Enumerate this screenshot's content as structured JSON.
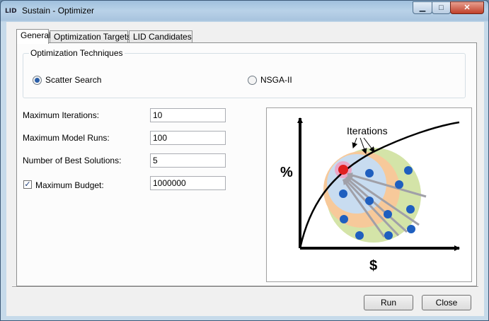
{
  "window": {
    "title": "Sustain - Optimizer",
    "app_icon_text": "LID",
    "min_glyph": "▁",
    "max_glyph": "□",
    "close_glyph": "✕"
  },
  "tabs": [
    {
      "label": "General",
      "active": true
    },
    {
      "label": "Optimization Targets",
      "active": false
    },
    {
      "label": "LID Candidates",
      "active": false
    }
  ],
  "techniques": {
    "group_label": "Optimization Techniques",
    "options": [
      {
        "label": "Scatter Search",
        "selected": true
      },
      {
        "label": "NSGA-II",
        "selected": false
      }
    ]
  },
  "fields": {
    "max_iterations": {
      "label": "Maximum Iterations:",
      "value": "10"
    },
    "max_model_runs": {
      "label": "Maximum Model Runs:",
      "value": "100"
    },
    "num_best_solutions": {
      "label": "Number of Best Solutions:",
      "value": "5"
    },
    "max_budget": {
      "label": "Maximum Budget:",
      "value": "1000000",
      "checked": true,
      "check_glyph": "✓"
    }
  },
  "diagram": {
    "iterations_label": "Iterations",
    "y_axis_label": "%",
    "x_axis_label": "$"
  },
  "buttons": {
    "run": "Run",
    "close": "Close"
  },
  "colors": {
    "titlebar": "#b9d2e8",
    "close_button": "#c0402a",
    "outer_ring": "#d4e4a8",
    "middle_ring": "#f7c99a",
    "inner_ring": "#c8dcf0",
    "dots": "#1f5fbf",
    "best_dot": "#e02020"
  }
}
